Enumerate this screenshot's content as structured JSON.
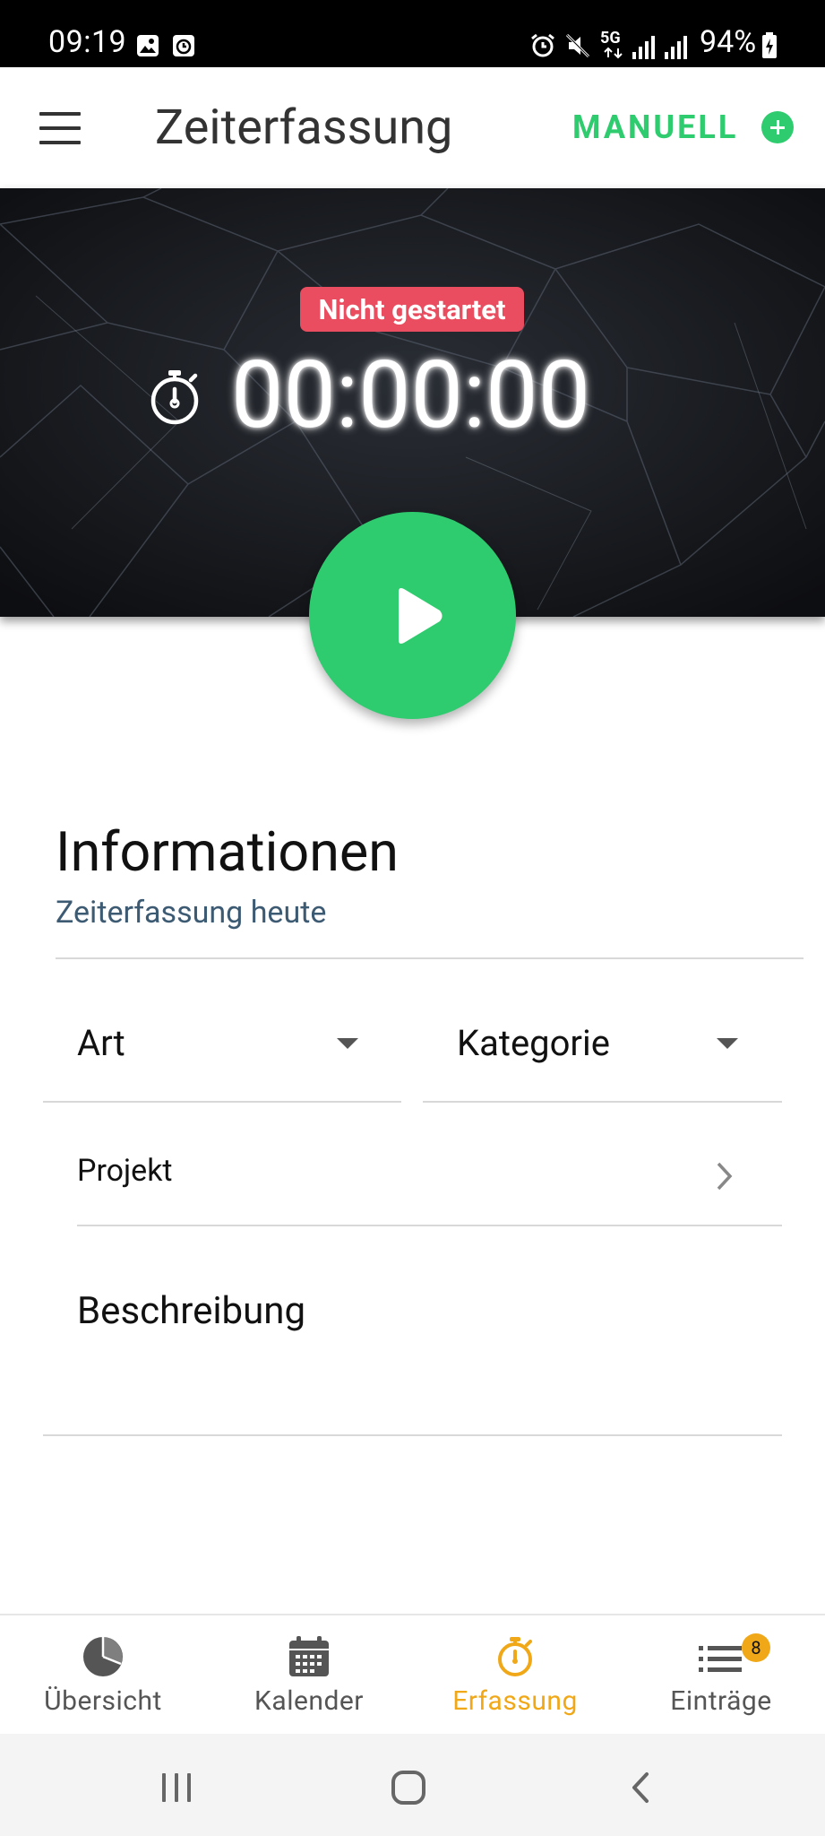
{
  "status_bar": {
    "time": "09:19",
    "battery": "94%",
    "network": "5G"
  },
  "app_bar": {
    "title": "Zeiterfassung",
    "manual_label": "MANUELL"
  },
  "timer": {
    "status": "Nicht gestartet",
    "display": "00:00:00"
  },
  "info": {
    "title": "Informationen",
    "subtitle": "Zeiterfassung heute"
  },
  "form": {
    "type_label": "Art",
    "category_label": "Kategorie",
    "project_label": "Projekt",
    "description_label": "Beschreibung"
  },
  "bottom_nav": {
    "items": [
      {
        "label": "Übersicht",
        "icon": "pie-chart-icon",
        "active": false
      },
      {
        "label": "Kalender",
        "icon": "calendar-icon",
        "active": false
      },
      {
        "label": "Erfassung",
        "icon": "stopwatch-icon",
        "active": true
      },
      {
        "label": "Einträge",
        "icon": "list-icon",
        "active": false,
        "badge": "8"
      }
    ]
  },
  "colors": {
    "accent_green": "#2ecc6e",
    "badge_red": "#e94d5f",
    "active_orange": "#f0a818",
    "subtitle_blue": "#3d5a73"
  }
}
